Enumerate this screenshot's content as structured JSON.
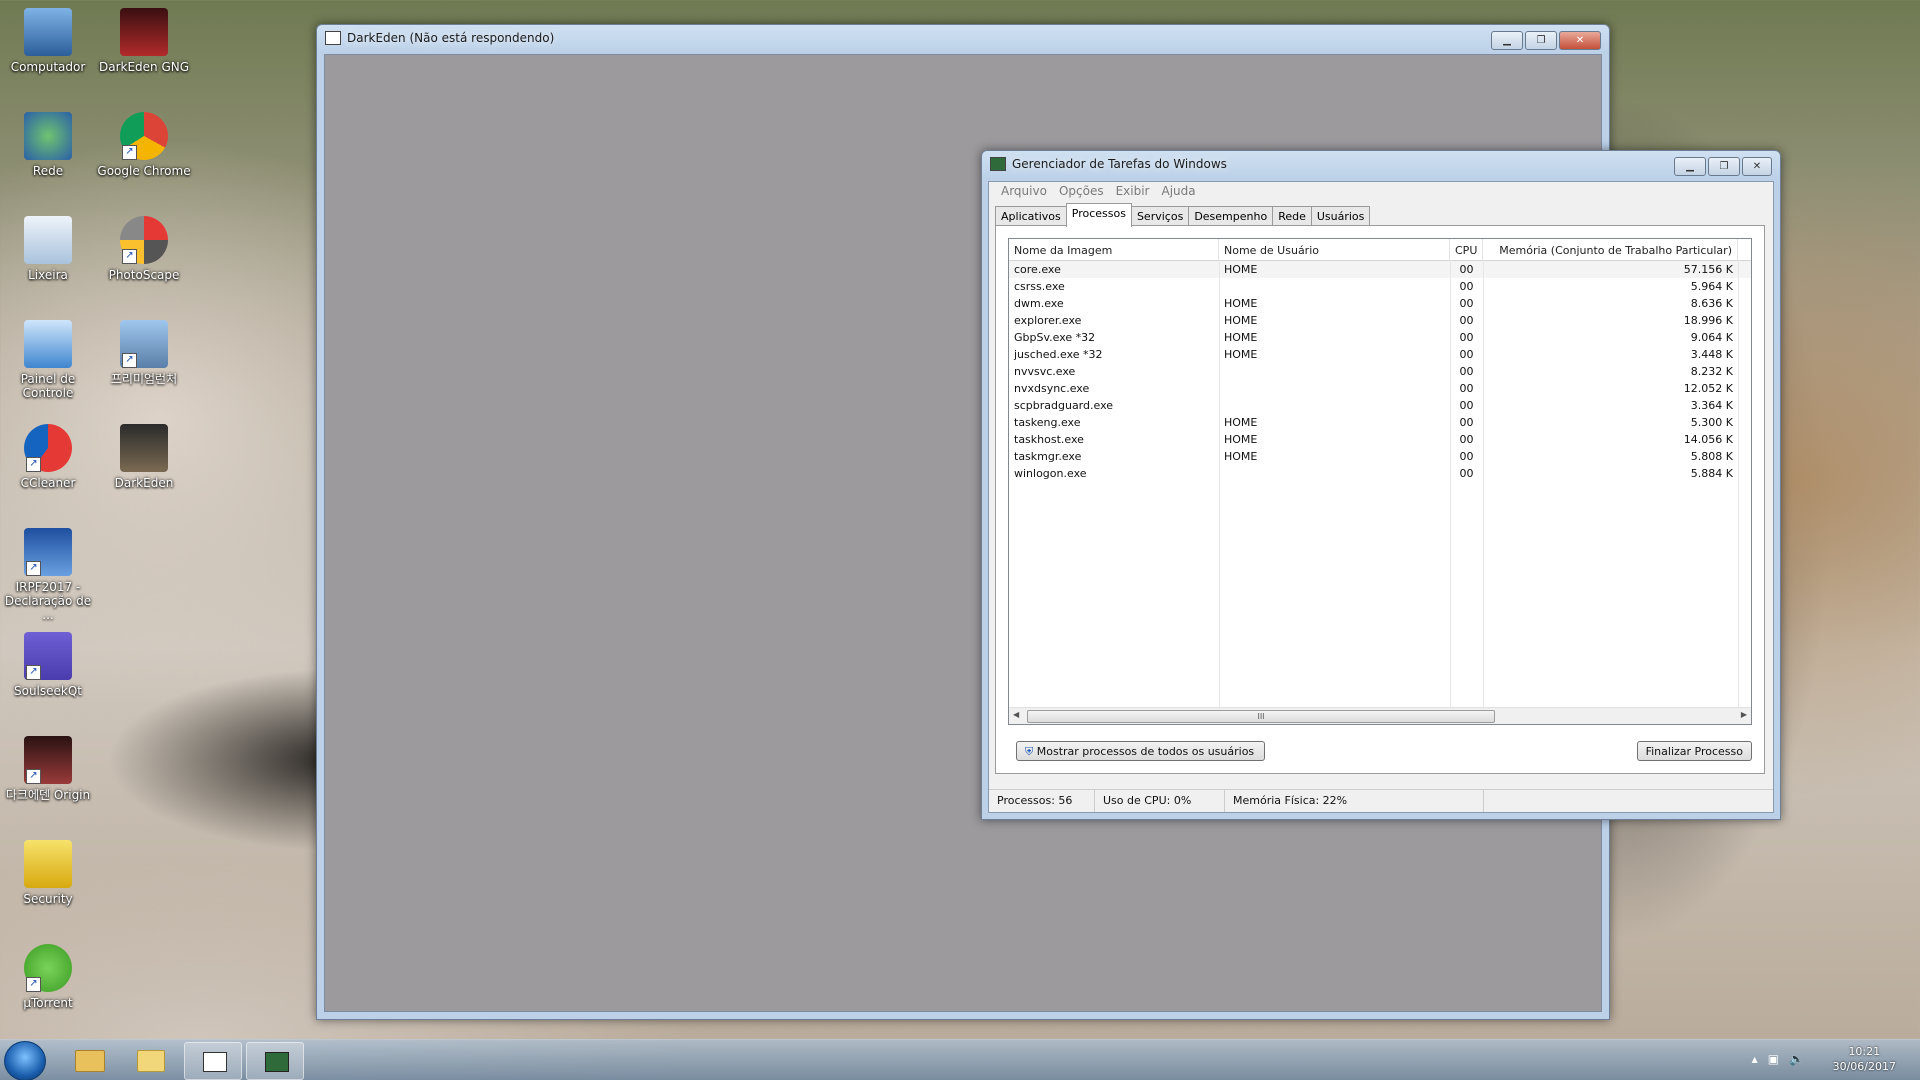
{
  "desktop_icons": [
    {
      "label": "Computador"
    },
    {
      "label": "DarkEden GNG"
    },
    {
      "label": "Rede"
    },
    {
      "label": "Google Chrome"
    },
    {
      "label": "Lixeira"
    },
    {
      "label": "PhotoScape"
    },
    {
      "label": "Painel de Controle"
    },
    {
      "label": "프리미엄런처"
    },
    {
      "label": "CCleaner"
    },
    {
      "label": "DarkEden"
    },
    {
      "label": "IRPF2017 - Declaração de ..."
    },
    {
      "label": "SoulseekQt"
    },
    {
      "label": "다크에덴 Origin"
    },
    {
      "label": "Security"
    },
    {
      "label": "µTorrent"
    }
  ],
  "game_window": {
    "title": "DarkEden (Não está respondendo)"
  },
  "task_manager": {
    "title": "Gerenciador de Tarefas do Windows",
    "menu": [
      "Arquivo",
      "Opções",
      "Exibir",
      "Ajuda"
    ],
    "tabs": [
      "Aplicativos",
      "Processos",
      "Serviços",
      "Desempenho",
      "Rede",
      "Usuários"
    ],
    "columns": [
      "Nome da Imagem",
      "Nome de Usuário",
      "CPU",
      "Memória (Conjunto de Trabalho Particular)"
    ],
    "rows": [
      {
        "name": "core.exe",
        "user": "HOME",
        "cpu": "00",
        "mem": "57.156 K"
      },
      {
        "name": "csrss.exe",
        "user": "",
        "cpu": "00",
        "mem": "5.964 K"
      },
      {
        "name": "dwm.exe",
        "user": "HOME",
        "cpu": "00",
        "mem": "8.636 K"
      },
      {
        "name": "explorer.exe",
        "user": "HOME",
        "cpu": "00",
        "mem": "18.996 K"
      },
      {
        "name": "GbpSv.exe *32",
        "user": "HOME",
        "cpu": "00",
        "mem": "9.064 K"
      },
      {
        "name": "jusched.exe *32",
        "user": "HOME",
        "cpu": "00",
        "mem": "3.448 K"
      },
      {
        "name": "nvvsvc.exe",
        "user": "",
        "cpu": "00",
        "mem": "8.232 K"
      },
      {
        "name": "nvxdsync.exe",
        "user": "",
        "cpu": "00",
        "mem": "12.052 K"
      },
      {
        "name": "scpbradguard.exe",
        "user": "",
        "cpu": "00",
        "mem": "3.364 K"
      },
      {
        "name": "taskeng.exe",
        "user": "HOME",
        "cpu": "00",
        "mem": "5.300 K"
      },
      {
        "name": "taskhost.exe",
        "user": "HOME",
        "cpu": "00",
        "mem": "14.056 K"
      },
      {
        "name": "taskmgr.exe",
        "user": "HOME",
        "cpu": "00",
        "mem": "5.808 K"
      },
      {
        "name": "winlogon.exe",
        "user": "",
        "cpu": "00",
        "mem": "5.884 K"
      }
    ],
    "scroll_grip": "III",
    "show_all_button": "Mostrar processos de todos os usuários",
    "end_process_button": "Finalizar Processo",
    "status": {
      "processes": "Processos: 56",
      "cpu": "Uso de CPU: 0%",
      "memory": "Memória Física: 22%"
    }
  },
  "taskbar": {
    "time": "10:21",
    "date": "30/06/2017"
  }
}
